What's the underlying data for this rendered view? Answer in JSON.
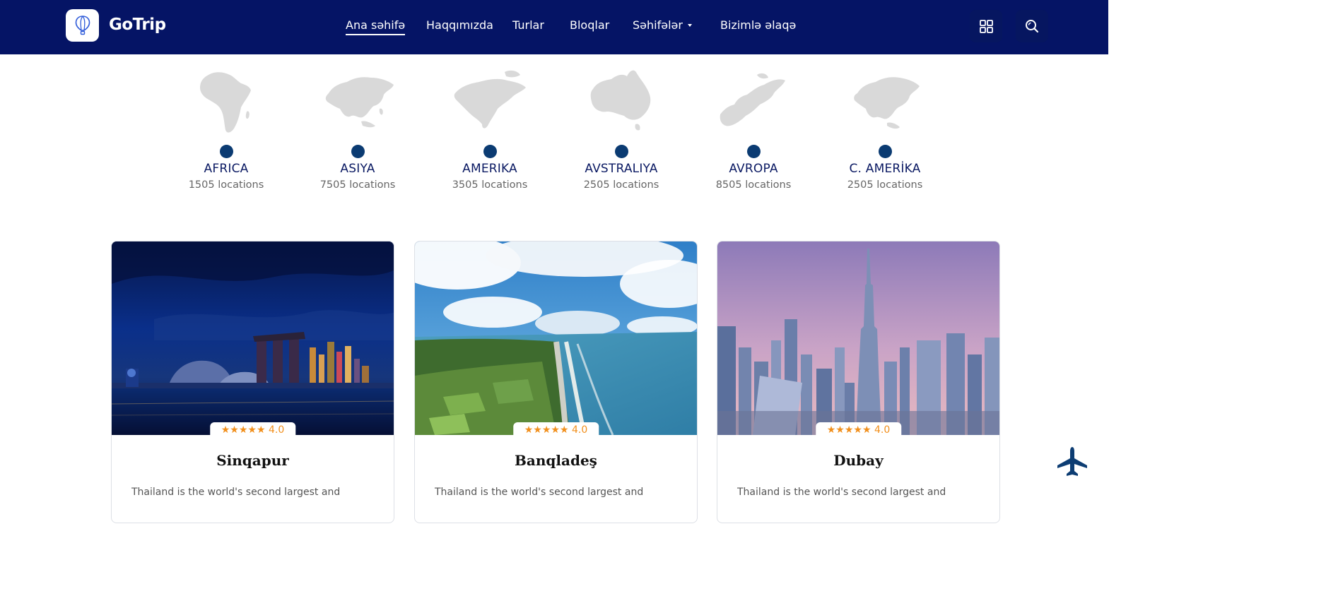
{
  "brand": {
    "name": "GoTrip",
    "logo_icon": "balloon-icon"
  },
  "nav": [
    {
      "label": "Ana səhifə",
      "active": true
    },
    {
      "label": "Haqqımızda"
    },
    {
      "label": "Turlar"
    },
    {
      "label": "Bloqlar"
    },
    {
      "label": "Səhifələr",
      "dropdown": true
    },
    {
      "label": "Bizimlə əlaqə"
    }
  ],
  "header_icons": [
    "grid-icon",
    "search-icon"
  ],
  "regions": [
    {
      "name": "AFRICA",
      "count": "1505 locations"
    },
    {
      "name": "ASIYA",
      "count": "7505 locations"
    },
    {
      "name": "AMERIKA",
      "count": "3505 locations"
    },
    {
      "name": "AVSTRALIYA",
      "count": "2505 locations"
    },
    {
      "name": "AVROPA",
      "count": "8505 locations"
    },
    {
      "name": "C. AMERİKA",
      "count": "2505 locations"
    }
  ],
  "tours": [
    {
      "title": "Sinqapur",
      "rating": "4.0",
      "stars": "★★★★★",
      "description": "Thailand is the world's second largest and"
    },
    {
      "title": "Banqladeş",
      "rating": "4.0",
      "stars": "★★★★★",
      "description": "Thailand is the world's second largest and"
    },
    {
      "title": "Dubay",
      "rating": "4.0",
      "stars": "★★★★★",
      "description": "Thailand is the world's second largest and"
    }
  ],
  "colors": {
    "header_bg": "#051465",
    "accent_orange": "#f18f1c",
    "dot": "#0b3b72",
    "region_name": "#0b1a63"
  },
  "floating_icon": "airplane-icon"
}
